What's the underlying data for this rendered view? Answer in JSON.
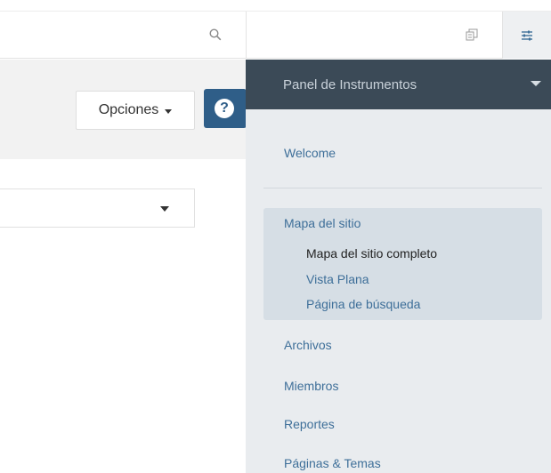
{
  "toolbar": {
    "search_icon": "search-icon",
    "copy_icon": "copy-icon",
    "settings_icon": "sliders-icon"
  },
  "header": {
    "options_label": "Opciones",
    "help_label": "?"
  },
  "panel": {
    "title": "Panel de Instrumentos",
    "welcome": "Welcome",
    "sitemap_group": {
      "title": "Mapa del sitio",
      "items": [
        {
          "label": "Mapa del sitio completo",
          "active": true
        },
        {
          "label": "Vista Plana",
          "active": false
        },
        {
          "label": "Página de búsqueda",
          "active": false
        }
      ]
    },
    "links": [
      {
        "label": "Archivos"
      },
      {
        "label": "Miembros"
      },
      {
        "label": "Reportes"
      },
      {
        "label": "Páginas & Temas"
      }
    ]
  },
  "colors": {
    "panel_header_bg": "#3b4a57",
    "panel_bg": "#e9ecef",
    "link": "#3e6f99",
    "help_button": "#2f5e88"
  }
}
